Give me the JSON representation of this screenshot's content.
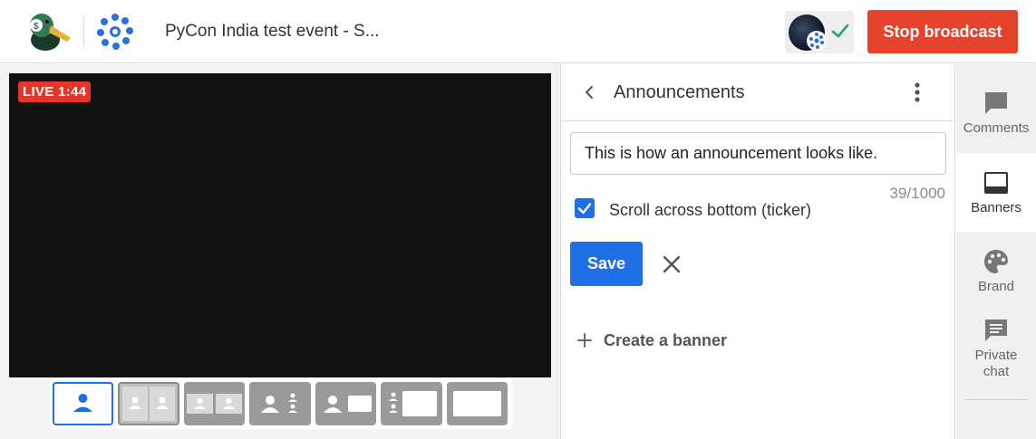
{
  "header": {
    "event_title": "PyCon India test event - S...",
    "stop_label": "Stop broadcast"
  },
  "stage": {
    "live_label": "LIVE 1:44"
  },
  "layouts": [
    {
      "name": "single-solo"
    },
    {
      "name": "two-group"
    },
    {
      "name": "two-split"
    },
    {
      "name": "three-group"
    },
    {
      "name": "person-and-screen"
    },
    {
      "name": "group-and-screen"
    },
    {
      "name": "screen-only"
    }
  ],
  "panel": {
    "title": "Announcements",
    "input_value": "This is how an announcement looks like.",
    "char_count": "39/1000",
    "ticker_label": "Scroll across bottom (ticker)",
    "ticker_checked": true,
    "save_label": "Save",
    "create_banner_label": "Create a banner"
  },
  "sidebar": {
    "items": [
      {
        "label": "Comments",
        "icon": "comment-icon"
      },
      {
        "label": "Banners",
        "icon": "banner-icon"
      },
      {
        "label": "Brand",
        "icon": "palette-icon"
      },
      {
        "label": "Private chat",
        "icon": "chat-icon"
      }
    ]
  },
  "colors": {
    "accent": "#1f6fe5",
    "stop": "#e5432c",
    "live": "#e5342c"
  }
}
